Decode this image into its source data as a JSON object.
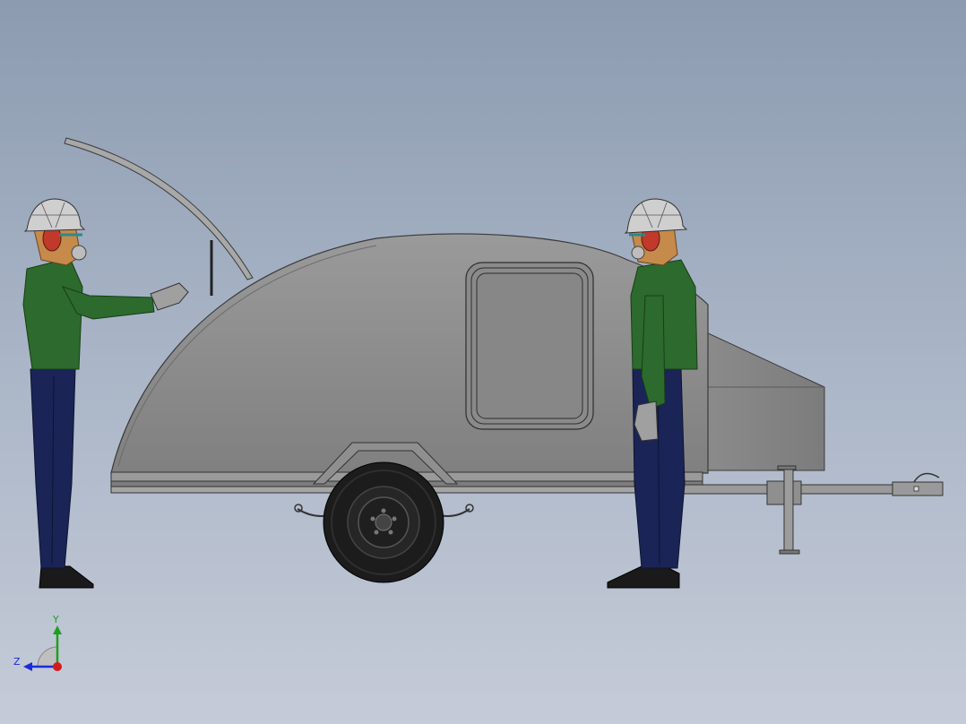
{
  "triad": {
    "y_label": "Y",
    "z_label": "Z",
    "y_color": "#1ea01e",
    "z_color": "#1a2bd6",
    "x_color": "#d41a1a"
  },
  "colors": {
    "trailer_body": "#8d8d8d",
    "trailer_outline": "#3a3a3a",
    "jacket": "#2d6a2d",
    "pants": "#1a2456",
    "helmet": "#cfcfcf",
    "earmuff": "#c0392b",
    "skin": "#c68a4a",
    "tire": "#1c1c1c"
  }
}
